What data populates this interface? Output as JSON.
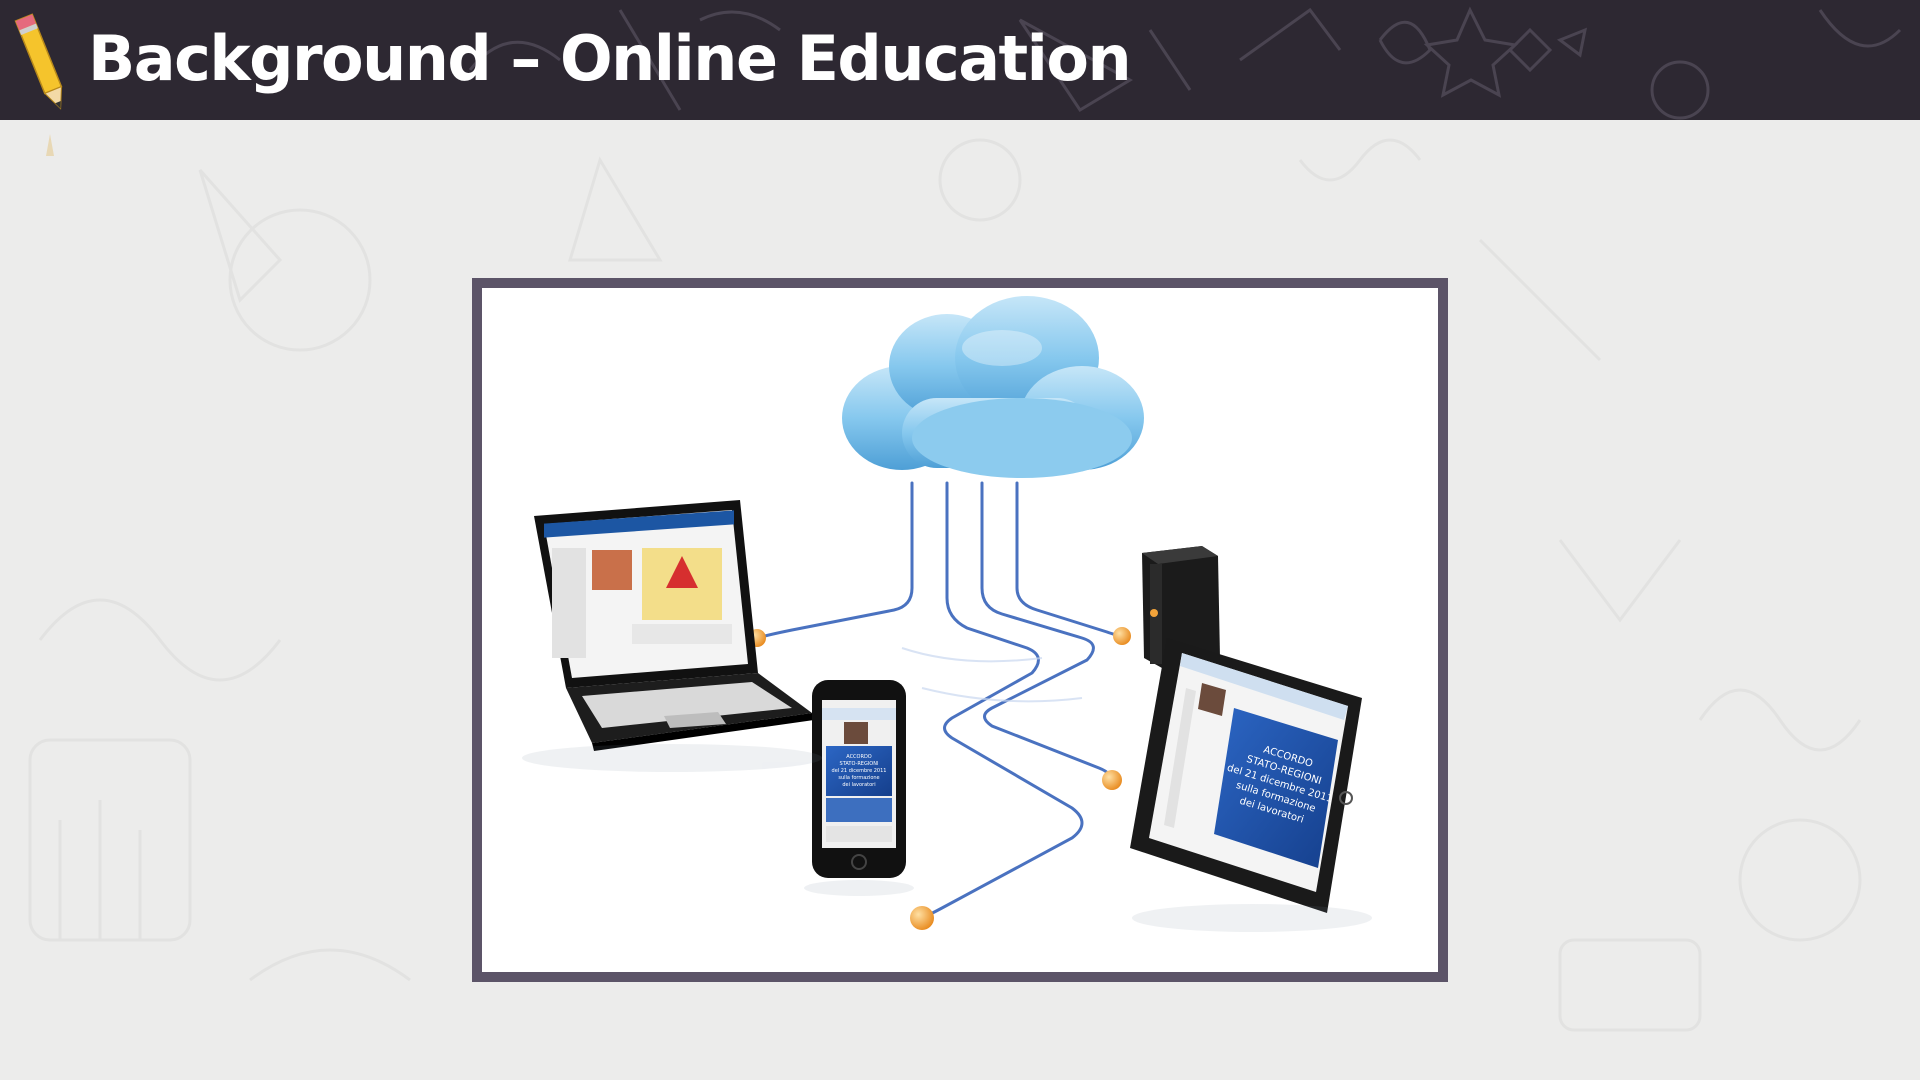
{
  "slide": {
    "title": "Background – Online Education"
  },
  "illustration": {
    "description_icons": [
      "cloud-icon",
      "laptop-icon",
      "smartphone-icon",
      "tablet-icon",
      "external-drive-icon"
    ],
    "laptop_screen": {},
    "phone_screen": {
      "lines": [
        "ACCORDO",
        "STATO-REGIONI",
        "del 21 dicembre 2011",
        "sulla formazione",
        "dei lavoratori"
      ]
    },
    "tablet_screen": {
      "lines": [
        "ACCORDO",
        "STATO-REGIONI",
        "del 21 dicembre 2011",
        "sulla formazione",
        "dei lavoratori"
      ]
    }
  },
  "colors": {
    "header": "#2d2832",
    "background": "#ececeb",
    "frame": "#5c5468",
    "cloud": "#7ec3ea",
    "cable": "#4a72c0",
    "node": "#f2a33a",
    "device_screen_blue": "#1d4fa8"
  }
}
